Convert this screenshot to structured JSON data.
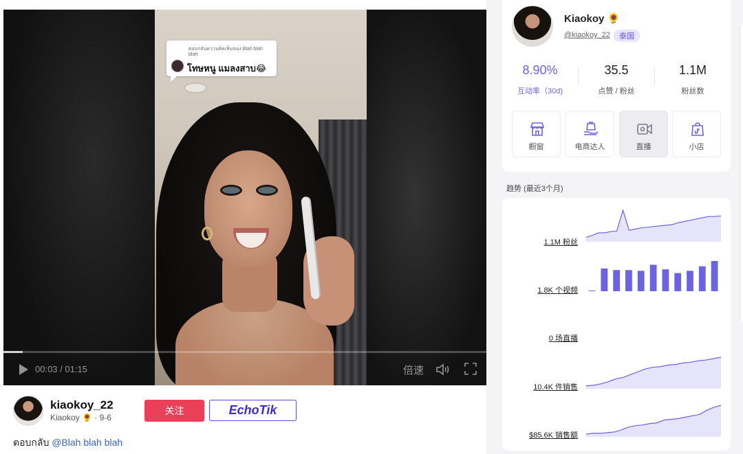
{
  "video": {
    "reply_header": "ตอบกลับความคิดเห็นของ Blah blah blah",
    "reply_text": "โทษหนู แมลงสาบ😂",
    "time": "00:03 / 01:15",
    "progress_fraction": 0.04,
    "speed_label": "倍速"
  },
  "author": {
    "username": "kiaokoy_22",
    "subline": "Kiaokoy 🌻 · 9-6",
    "follow_label": "关注",
    "echotik_label": "EchoTik",
    "caption_prefix": "ตอบกลับ ",
    "caption_mention": "@Blah blah blah"
  },
  "profile": {
    "name": "Kiaokoy 🌻",
    "handle": "@kiaokoy_22",
    "country": "泰国",
    "stats": [
      {
        "value": "8.90%",
        "label": "互动率（30d)",
        "accent": true
      },
      {
        "value": "35.5",
        "label": "点赞 / 粉丝",
        "accent": false
      },
      {
        "value": "1.1M",
        "label": "粉丝数",
        "accent": false
      }
    ],
    "features": [
      {
        "label": "橱窗",
        "icon": "storefront-icon",
        "active": false
      },
      {
        "label": "电商达人",
        "icon": "shopping-bag-hand-icon",
        "active": false
      },
      {
        "label": "直播",
        "icon": "live-camera-icon",
        "active": true
      },
      {
        "label": "小店",
        "icon": "tiktok-shop-icon",
        "active": false
      }
    ]
  },
  "trends": {
    "title": "趋势 (最近3个月)",
    "accent": "#6c63e0",
    "rows": [
      {
        "label": "1.1M 粉丝",
        "type": "area",
        "values": [
          5,
          8,
          12,
          12,
          14,
          15,
          48,
          16,
          18,
          20,
          21,
          22,
          23,
          24,
          25,
          28,
          30,
          32,
          34,
          36,
          38,
          38,
          39
        ]
      },
      {
        "label": "1.8K 个视频",
        "type": "bar",
        "values": [
          0,
          30,
          28,
          28,
          27,
          35,
          29,
          24,
          27,
          33,
          40
        ]
      },
      {
        "label": "0 场直播",
        "type": "none",
        "values": []
      },
      {
        "label": "10.4K 件销售",
        "type": "area",
        "values": [
          2,
          3,
          5,
          8,
          12,
          14,
          18,
          22,
          26,
          28,
          29,
          31,
          32,
          34,
          35,
          37,
          38,
          40,
          42
        ]
      },
      {
        "label": "$85.6K 销售额",
        "type": "area",
        "values": [
          2,
          3,
          3,
          4,
          5,
          8,
          12,
          14,
          15,
          17,
          18,
          22,
          23,
          24,
          26,
          28,
          30,
          36,
          40,
          43
        ]
      }
    ]
  }
}
